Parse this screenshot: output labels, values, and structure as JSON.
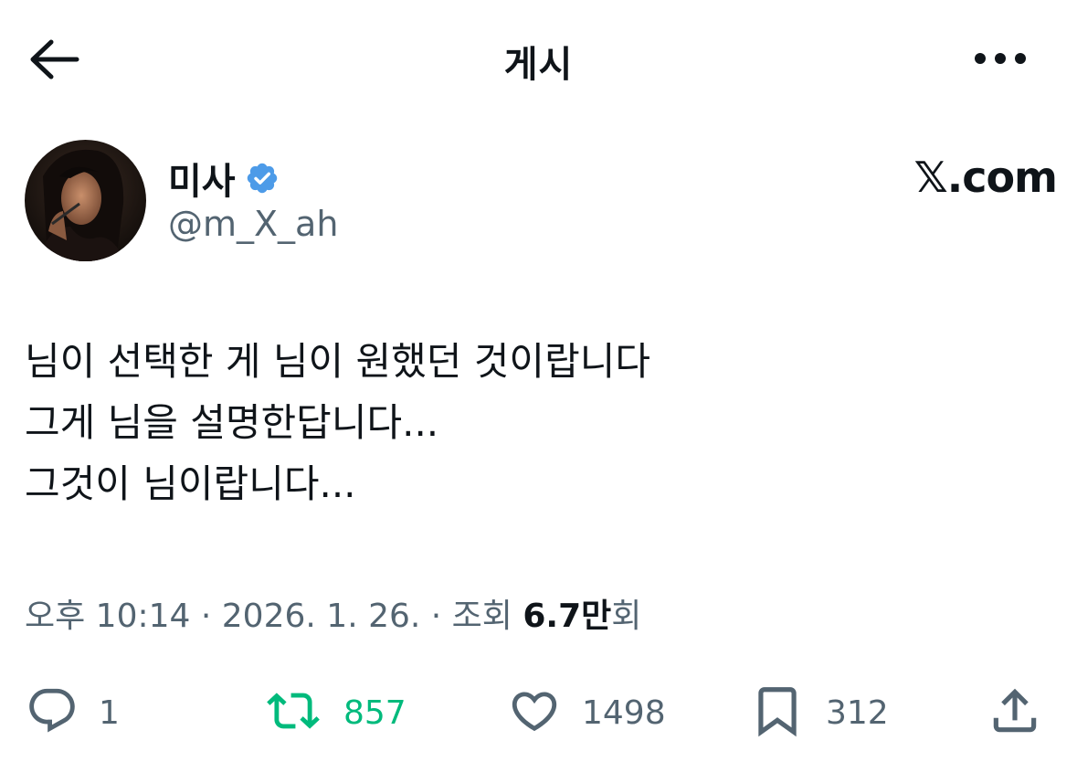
{
  "header": {
    "title": "게시",
    "back_icon": "arrow-left-icon",
    "more_icon": "more-horizontal-icon"
  },
  "author": {
    "display_name": "미사",
    "handle": "@m_X_ah",
    "verified": true,
    "verified_color": "#4d9be8",
    "brand": "𝕏.com"
  },
  "tweet": {
    "lines": [
      "님이 선택한 게 님이 원했던 것이랍니다",
      "그게 님을 설명한답니다...",
      "그것이 님이랍니다..."
    ]
  },
  "meta": {
    "time": "오후 10:14",
    "separator": " · ",
    "date": "2026. 1. 26.",
    "views_label": "조회",
    "views_count": "6.7만",
    "views_suffix": "회"
  },
  "actions": {
    "reply": {
      "icon": "reply-icon",
      "count": "1"
    },
    "retweet": {
      "icon": "retweet-icon",
      "count": "857",
      "color": "#00ba7c"
    },
    "like": {
      "icon": "heart-icon",
      "count": "1498"
    },
    "bookmark": {
      "icon": "bookmark-icon",
      "count": "312"
    },
    "share": {
      "icon": "share-icon"
    }
  },
  "colors": {
    "text_primary": "#0f1419",
    "text_secondary": "#536471",
    "retweet_green": "#00ba7c",
    "background": "#ffffff"
  }
}
